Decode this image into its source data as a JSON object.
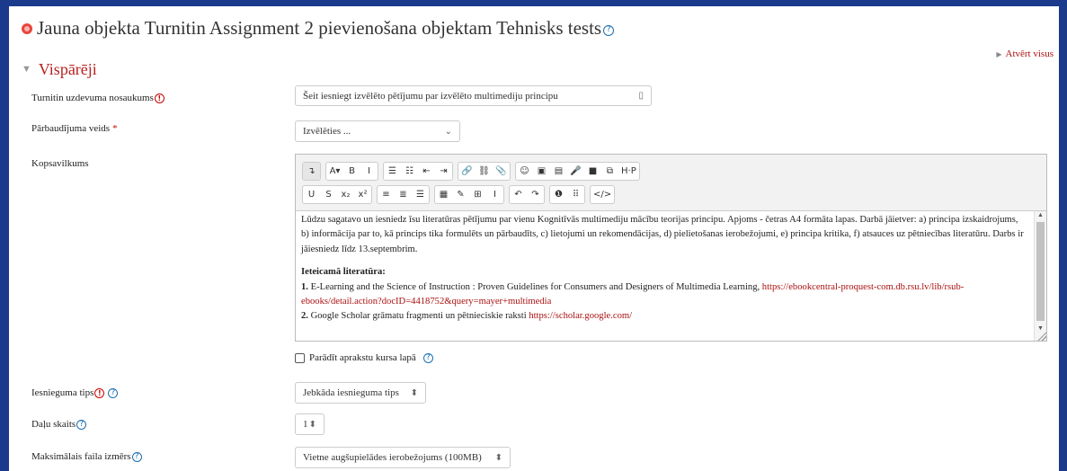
{
  "page": {
    "title": "Jauna objekta Turnitin Assignment 2 pievienošana objektam Tehnisks tests",
    "help_glyph": "?",
    "expand_all": "Atvērt visus",
    "section": "Vispārēji"
  },
  "form": {
    "assignment_name": {
      "label": "Turnitin uzdevuma nosaukums",
      "value": "Šeit iesniegt izvēlēto pētījumu par izvēlēto multimediju principu"
    },
    "check_type": {
      "label": "Pārbaudījuma veids",
      "required_mark": "*",
      "value": "Izvēlēties ..."
    },
    "summary": {
      "label": "Kopsavilkums"
    },
    "show_description": {
      "label": "Parādīt aprakstu kursa lapā"
    },
    "submission_type": {
      "label": "Iesnieguma tips",
      "value": "Jebkāda iesnieguma tips"
    },
    "parts_count": {
      "label": "Daļu skaits",
      "value": "1"
    },
    "max_file_size": {
      "label": "Maksimālais faila izmērs",
      "value": "Vietne augšupielādes ierobežojums (100MB)"
    }
  },
  "editor": {
    "toolbar_row1": [
      [
        "↴"
      ],
      [
        "A▾",
        "B",
        "I"
      ],
      [
        "☰",
        "☷",
        "⇤",
        "⇥"
      ],
      [
        "🔗",
        "⛓",
        "📎"
      ],
      [
        "☺",
        "▣",
        "▤",
        "🎤",
        "■",
        "⧉",
        "H·P"
      ]
    ],
    "toolbar_row2": [
      [
        "U",
        "S",
        "x₂",
        "x²"
      ],
      [
        "≡",
        "≣",
        "☰"
      ],
      [
        "▦",
        "✎",
        "⊞",
        "I"
      ],
      [
        "↶",
        "↷"
      ],
      [
        "❶",
        "⠿"
      ],
      [
        "</>"
      ]
    ],
    "paragraph1": "Lūdzu sagatavo un iesniedz īsu literatūras pētījumu par vienu Kognitīvās multimediju mācību teorijas principu. Apjoms - četras A4 formāta lapas. Darbā jāietver: a) principa izskaidrojums, b) informācija par to, kā princips tika formulēts un pārbaudīts, c) lietojumi un rekomendācijas, d) pielietošanas ierobežojumi, e) principa kritika, f) atsauces uz pētniecības literatūru. Darbs ir jāiesniedz līdz 13.septembrim.",
    "lit_heading": "Ieteicamā literatūra:",
    "item1_num": "1.",
    "item1_text": " E-Learning and the Science of Instruction : Proven Guidelines for Consumers and Designers of Multimedia Learning, ",
    "item1_link": "https://ebookcentral-proquest-com.db.rsu.lv/lib/rsub-ebooks/detail.action?docID=4418752&query=mayer+multimedia",
    "item2_num": "2.",
    "item2_text": " Google Scholar grāmatu fragmenti un pētnieciskie raksti ",
    "item2_link": "https://scholar.google.com/"
  },
  "colors": {
    "accent_red": "#b61f1f",
    "link": "#aa1111",
    "help_blue": "#1b6fb3",
    "frame_blue": "#1b3a8c"
  }
}
